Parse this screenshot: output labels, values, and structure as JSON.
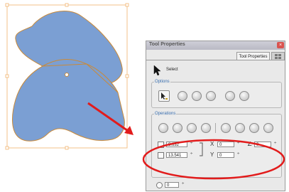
{
  "panel": {
    "title": "Tool Properties",
    "close_glyph": "×",
    "tabs": [
      {
        "label": "Tool Properties",
        "active": true
      },
      {
        "label": "",
        "active": false
      }
    ],
    "select_label": "Select"
  },
  "options": {
    "group_label": "Options",
    "buttons": [
      "snap-contour-icon",
      "snap-point-icon",
      "snap-grid-icon",
      "preview-icon",
      "print-icon",
      "apply-icon"
    ]
  },
  "operations": {
    "group_label": "Operations",
    "buttons": [
      "flip-horizontal-icon",
      "flip-vertical-icon",
      "rotate-ccw-icon",
      "rotate-cw-icon",
      "align-icon",
      "edit-icon",
      "color-icon"
    ],
    "width_value": "8.632",
    "height_value": "13.541",
    "x_value": "0",
    "y_value": "0",
    "angle_value": "0",
    "spin_glyph": "÷",
    "x_glyph": "X",
    "y_glyph": "Y",
    "angle_glyph": "∠"
  },
  "extra": {
    "value": "0",
    "spin_glyph": "÷"
  },
  "colors": {
    "shape_fill": "#7b9fd3",
    "shape_stroke": "#c98a3a",
    "bbox": "#f3c28a",
    "highlight": "#e21b1b",
    "accent": "#3a6fb0"
  }
}
